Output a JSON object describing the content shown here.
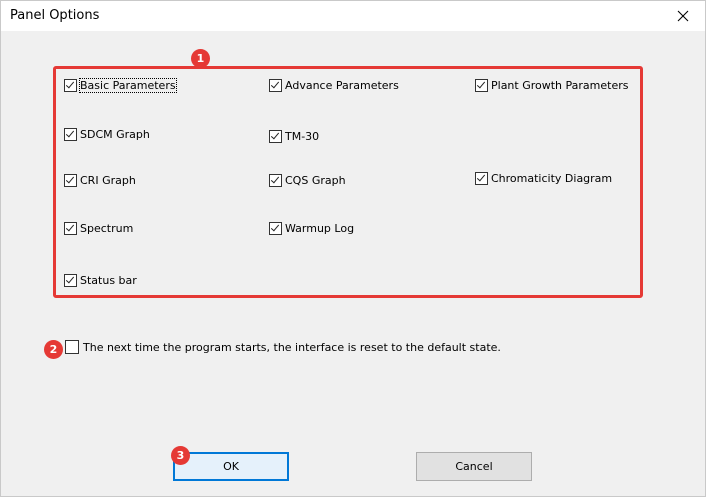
{
  "window": {
    "title": "Panel Options"
  },
  "badges": {
    "b1": "1",
    "b2": "2",
    "b3": "3"
  },
  "panels": [
    {
      "label": "Basic Parameters",
      "checked": true
    },
    {
      "label": "Advance Parameters",
      "checked": true
    },
    {
      "label": "Plant Growth Parameters",
      "checked": true
    },
    {
      "label": "SDCM Graph",
      "checked": true
    },
    {
      "label": "TM-30",
      "checked": true
    },
    {
      "label": "CRI Graph",
      "checked": true
    },
    {
      "label": "CQS Graph",
      "checked": true
    },
    {
      "label": "Chromaticity Diagram",
      "checked": true
    },
    {
      "label": "Spectrum",
      "checked": true
    },
    {
      "label": "Warmup Log",
      "checked": true
    },
    {
      "label": "Status bar",
      "checked": true
    }
  ],
  "reset": {
    "label": "The next time the program starts, the interface is reset to the default state.",
    "checked": false
  },
  "buttons": {
    "ok": "OK",
    "cancel": "Cancel"
  },
  "colors": {
    "highlight": "#e53935",
    "focus": "#0078d7"
  }
}
